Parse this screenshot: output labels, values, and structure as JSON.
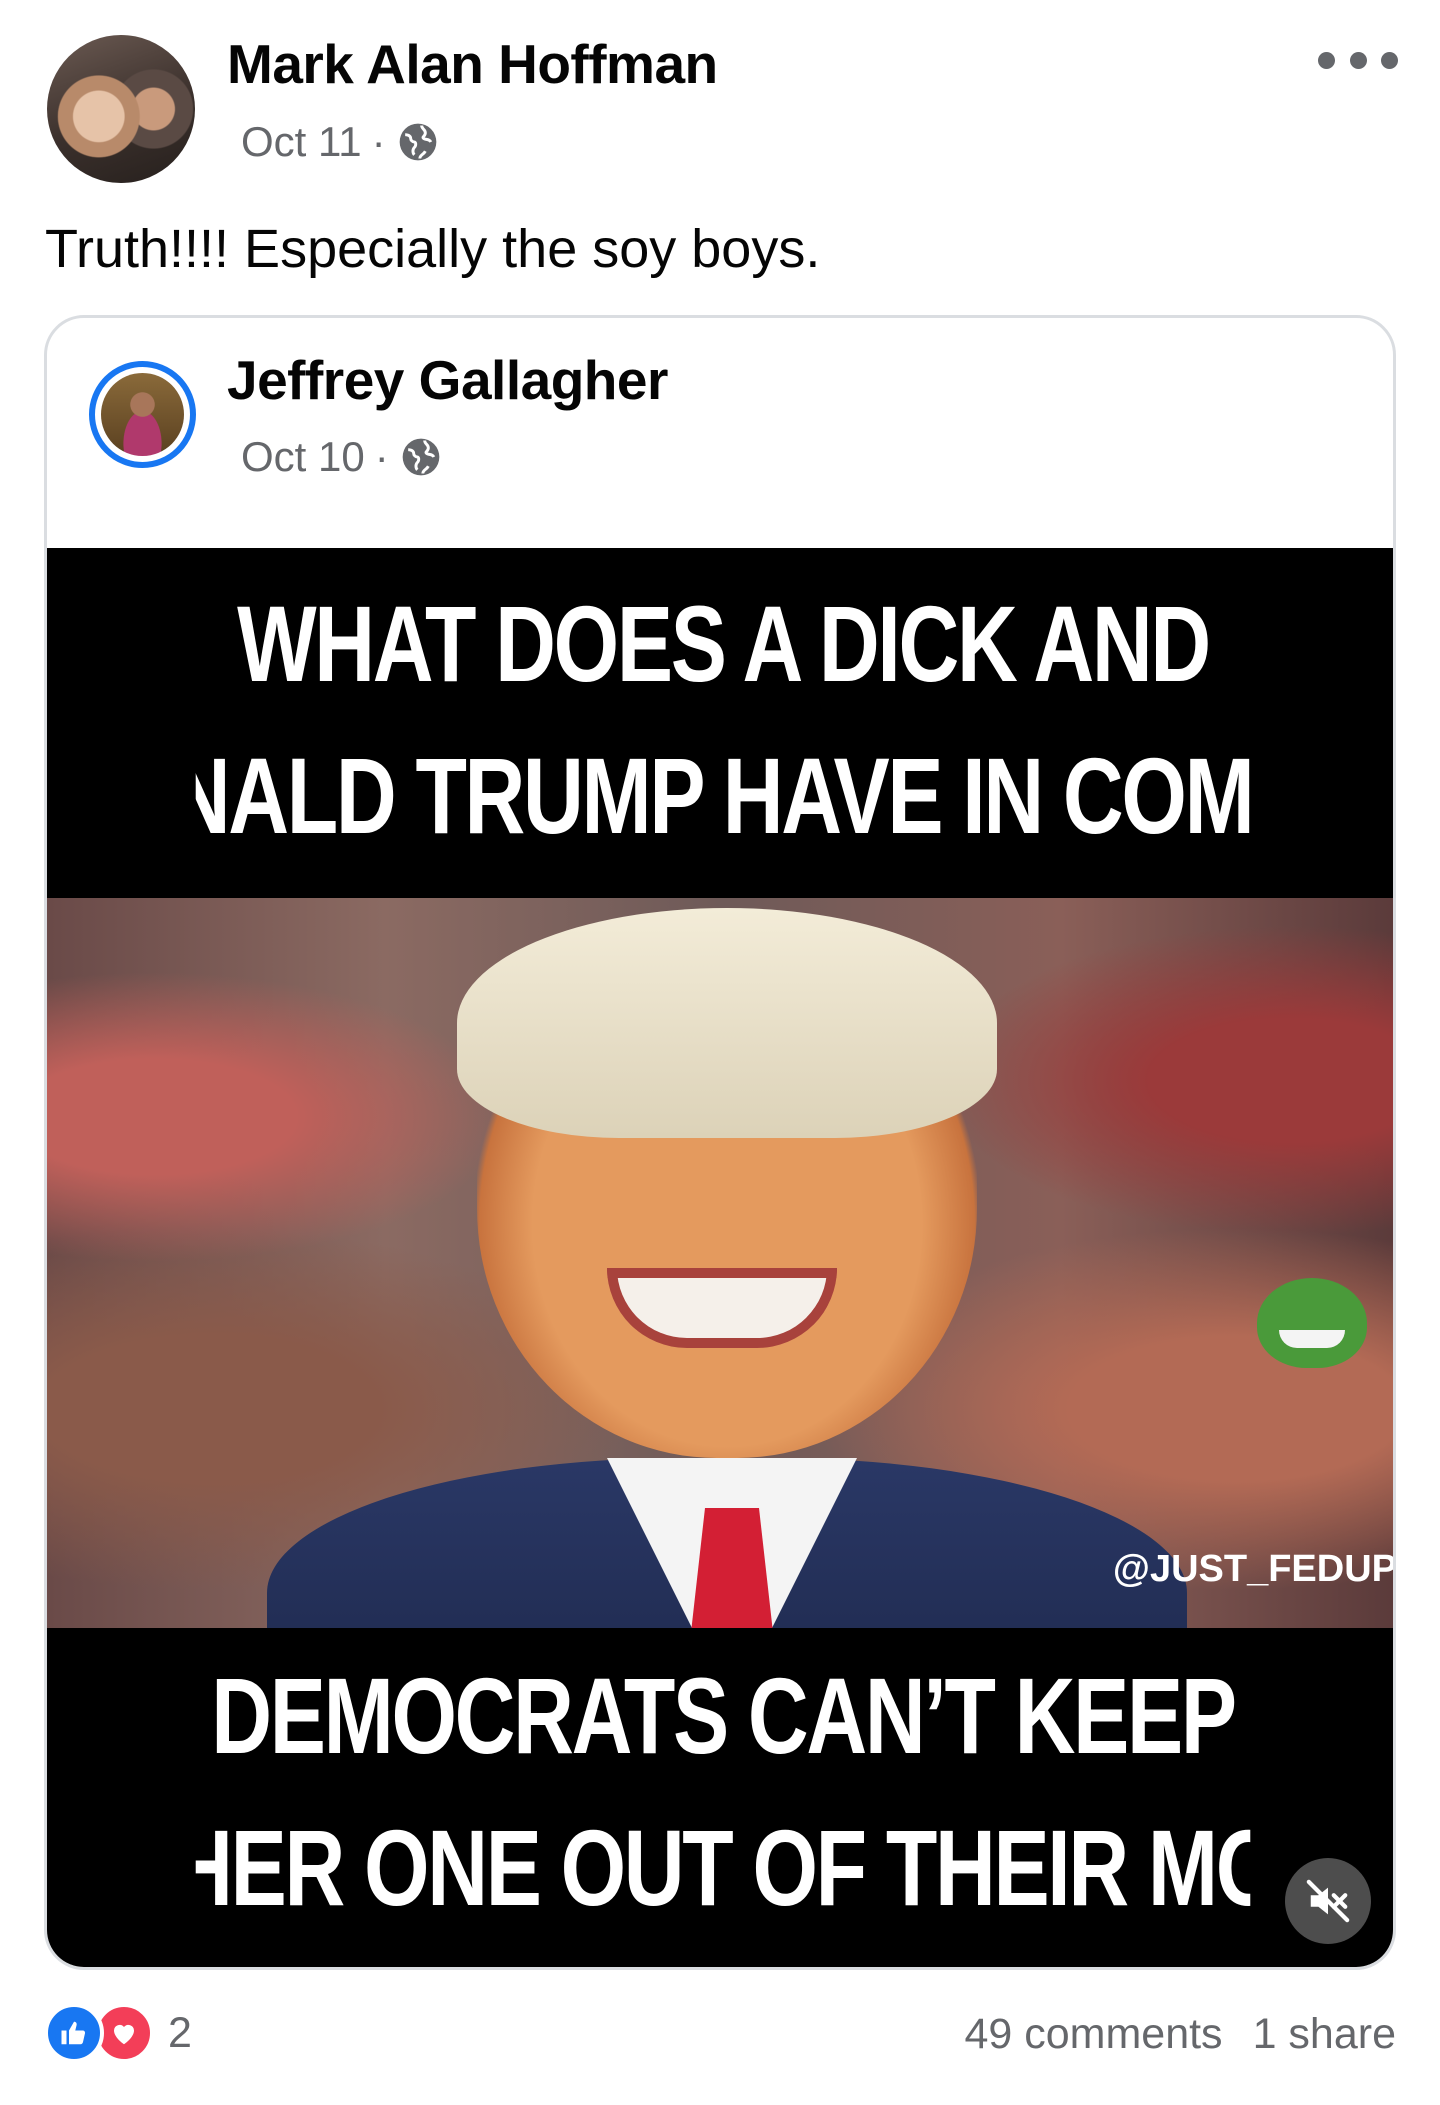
{
  "post": {
    "author": "Mark Alan Hoffman",
    "date": "Oct 11",
    "separator": "·",
    "audience_icon": "globe-icon",
    "caption": "Truth!!!! Especially the soy boys."
  },
  "shared": {
    "author": "Jeffrey Gallagher",
    "date": "Oct 10",
    "separator": "·",
    "audience_icon": "globe-icon",
    "meme": {
      "top_line_1": "WHAT DOES A DICK AND",
      "top_line_2": "DONALD TRUMP HAVE IN COMMON?",
      "bottom_line_1": "DEMOCRATS CAN’T KEEP",
      "bottom_line_2": "EITHER ONE OUT OF THEIR MOUTH",
      "watermark": "@JUST_FEDUP"
    }
  },
  "footer": {
    "reaction_count": "2",
    "comments": "49 comments",
    "shares": "1 share"
  },
  "colors": {
    "text_primary": "#050505",
    "text_secondary": "#65676b",
    "like_blue": "#1877f2",
    "love_red": "#f33e58",
    "card_border": "#dadde1"
  }
}
